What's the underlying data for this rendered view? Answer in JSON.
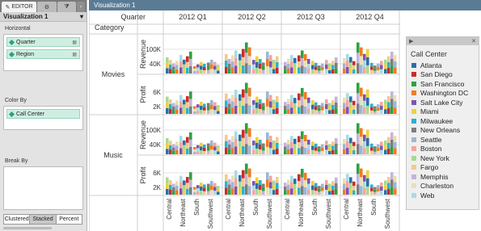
{
  "editor": {
    "tab_label": "EDITOR",
    "viz_title": "Visualization 1"
  },
  "shelves": {
    "horizontal_label": "Horizontal",
    "horizontal_items": [
      "Quarter",
      "Region"
    ],
    "color_label": "Color By",
    "color_items": [
      "Call Center"
    ],
    "break_label": "Break By"
  },
  "modes": [
    "Clustered",
    "Stacked",
    "Percent"
  ],
  "panel": {
    "title": "Visualization 1"
  },
  "header": {
    "quarter_label": "Quarter",
    "category_label": "Category",
    "quarters": [
      "2012 Q1",
      "2012 Q2",
      "2012 Q3",
      "2012 Q4"
    ]
  },
  "legend": {
    "title": "Call Center",
    "items": [
      {
        "name": "Atlanta",
        "color": "#2b6fa8"
      },
      {
        "name": "San Diego",
        "color": "#c92b2b"
      },
      {
        "name": "San Francisco",
        "color": "#2ba33f"
      },
      {
        "name": "Washington DC",
        "color": "#f07d22"
      },
      {
        "name": "Salt Lake City",
        "color": "#7c55b0"
      },
      {
        "name": "Miami",
        "color": "#f2cf3d"
      },
      {
        "name": "Milwaukee",
        "color": "#2bb3c7"
      },
      {
        "name": "New Orleans",
        "color": "#7d7d7d"
      },
      {
        "name": "Seattle",
        "color": "#9cb7d7"
      },
      {
        "name": "Boston",
        "color": "#f5a59c"
      },
      {
        "name": "New York",
        "color": "#a5db8f"
      },
      {
        "name": "Fargo",
        "color": "#f7c98b"
      },
      {
        "name": "Memphis",
        "color": "#c6b2db"
      },
      {
        "name": "Charleston",
        "color": "#ecdeb5"
      },
      {
        "name": "Web",
        "color": "#a8dbe7"
      }
    ]
  },
  "chart_data": {
    "type": "bar",
    "stacked": true,
    "grouping": "clustered",
    "columns": {
      "quarters": [
        "2012 Q1",
        "2012 Q2",
        "2012 Q3",
        "2012 Q4"
      ],
      "regions": [
        "Central",
        "Northeast",
        "South",
        "Southwest"
      ]
    },
    "rows": {
      "categories": [
        "Movies",
        "Music"
      ],
      "measures": [
        "Revenue",
        "Profit"
      ]
    },
    "axes": {
      "Revenue": {
        "ticks": [
          "40K",
          "100K"
        ],
        "ylim": [
          0,
          150000
        ]
      },
      "Profit": {
        "ticks": [
          "2K",
          "6K"
        ],
        "ylim": [
          0,
          10000
        ]
      }
    },
    "panes": [
      {
        "category": "Movies",
        "measure": "Revenue",
        "quarters": [
          {
            "region_totals": [
              70000,
              95000,
              50000,
              60000
            ]
          },
          {
            "region_totals": [
              100000,
              135000,
              75000,
              95000
            ]
          },
          {
            "region_totals": [
              80000,
              100000,
              55000,
              70000
            ]
          },
          {
            "region_totals": [
              85000,
              135000,
              55000,
              95000
            ]
          }
        ]
      },
      {
        "category": "Movies",
        "measure": "Profit",
        "quarters": [
          {
            "region_totals": [
              5000,
              6500,
              3500,
              4000
            ]
          },
          {
            "region_totals": [
              7000,
              9000,
              5000,
              6500
            ]
          },
          {
            "region_totals": [
              5500,
              7500,
              4000,
              5000
            ]
          },
          {
            "region_totals": [
              6000,
              9000,
              3500,
              6500
            ]
          }
        ]
      },
      {
        "category": "Music",
        "measure": "Revenue",
        "quarters": [
          {
            "region_totals": [
              70000,
              95000,
              50000,
              60000
            ]
          },
          {
            "region_totals": [
              100000,
              135000,
              75000,
              95000
            ]
          },
          {
            "region_totals": [
              80000,
              100000,
              55000,
              70000
            ]
          },
          {
            "region_totals": [
              85000,
              135000,
              55000,
              95000
            ]
          }
        ]
      },
      {
        "category": "Music",
        "measure": "Profit",
        "quarters": [
          {
            "region_totals": [
              5000,
              6500,
              3500,
              4000
            ]
          },
          {
            "region_totals": [
              7000,
              9000,
              5000,
              6500
            ]
          },
          {
            "region_totals": [
              5500,
              7500,
              4000,
              5000
            ]
          },
          {
            "region_totals": [
              6000,
              9000,
              3500,
              6500
            ]
          }
        ]
      }
    ]
  }
}
